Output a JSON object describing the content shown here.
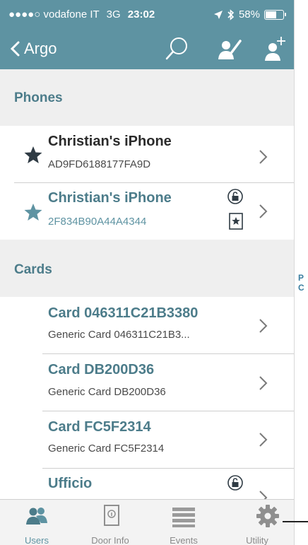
{
  "status_bar": {
    "signal": "●●●●○",
    "carrier": "vodafone IT",
    "network": "3G",
    "time": "23:02",
    "battery": "58%",
    "battery_level": 0.58
  },
  "nav": {
    "back_label": "Argo",
    "icons": [
      "search-icon",
      "edit-user-icon",
      "add-user-icon"
    ]
  },
  "sections": {
    "phones": {
      "header": "Phones",
      "items": [
        {
          "title": "Christian's iPhone",
          "subtitle": "AD9FD6188177FA9D"
        },
        {
          "title": "Christian's iPhone",
          "subtitle": "2F834B90A44A4344"
        }
      ]
    },
    "cards": {
      "header": "Cards",
      "items": [
        {
          "title": "Card 046311C21B3380",
          "subtitle": "Generic Card 046311C21B3..."
        },
        {
          "title": "Card DB200D36",
          "subtitle": "Generic Card DB200D36"
        },
        {
          "title": "Card FC5F2314",
          "subtitle": "Generic Card FC5F2314"
        },
        {
          "title": "Ufficio",
          "subtitle": ""
        }
      ]
    }
  },
  "side_index": [
    "P",
    "C"
  ],
  "tabs": [
    {
      "label": "Users",
      "icon": "users-icon",
      "active": true
    },
    {
      "label": "Door Info",
      "icon": "door-icon",
      "active": false
    },
    {
      "label": "Events",
      "icon": "list-icon",
      "active": false
    },
    {
      "label": "Utility",
      "icon": "gear-icon",
      "active": false
    }
  ],
  "colors": {
    "accent": "#5e93a2",
    "header_text": "#4c7c8a",
    "section_bg": "#efefef"
  }
}
